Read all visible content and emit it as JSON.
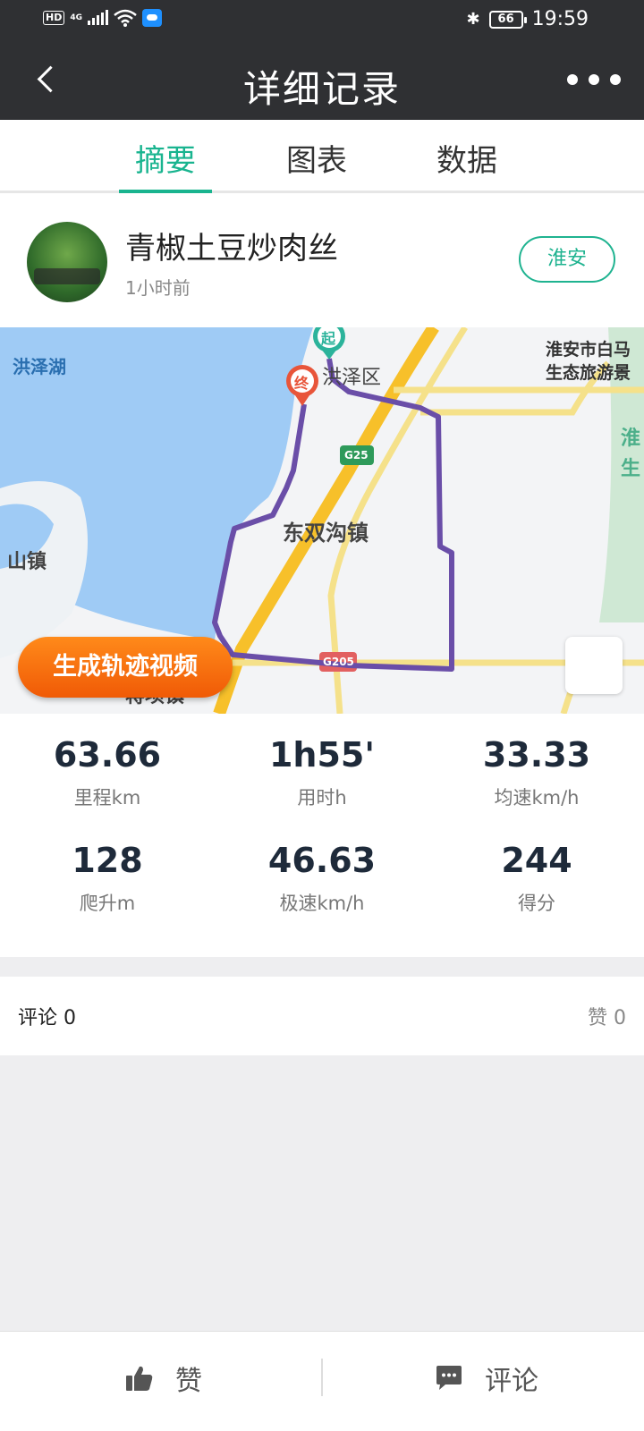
{
  "status_bar": {
    "hd": "HD",
    "network": "4G",
    "battery": "66",
    "time": "19:59"
  },
  "header": {
    "title": "详细记录"
  },
  "tabs": [
    {
      "label": "摘要",
      "active": true
    },
    {
      "label": "图表",
      "active": false
    },
    {
      "label": "数据",
      "active": false
    }
  ],
  "profile": {
    "name": "青椒土豆炒肉丝",
    "time_ago": "1小时前",
    "city": "淮安"
  },
  "map": {
    "labels": {
      "lake": "洪泽湖",
      "district": "洪泽区",
      "town1": "东双沟镇",
      "town2": "山镇",
      "town3": "蒋坝镇",
      "scenic_line1": "淮安市白马",
      "scenic_line2": "生态旅游景",
      "edge_1": "淮",
      "edge_2": "生",
      "hw1": "G25",
      "hw2": "G205",
      "start_marker": "起",
      "end_marker": "终"
    },
    "route_color": "#6a4ea8",
    "generate_video_label": "生成轨迹视频"
  },
  "stats": [
    {
      "value": "63.66",
      "label": "里程km"
    },
    {
      "value": "1h55'",
      "label": "用时h"
    },
    {
      "value": "33.33",
      "label": "均速km/h"
    },
    {
      "value": "128",
      "label": "爬升m"
    },
    {
      "value": "46.63",
      "label": "极速km/h"
    },
    {
      "value": "244",
      "label": "得分"
    }
  ],
  "comments_bar": {
    "comments_label": "评论",
    "comments_count": "0",
    "likes_label": "赞",
    "likes_count": "0"
  },
  "bottom_bar": {
    "like_label": "赞",
    "comment_label": "评论"
  }
}
